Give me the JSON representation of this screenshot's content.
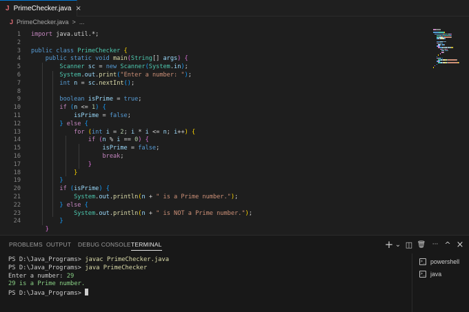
{
  "tab": {
    "icon": "java-icon",
    "icon_glyph": "J",
    "title": "PrimeChecker.java",
    "close": "×"
  },
  "breadcrumb": {
    "file": "PrimeChecker.java",
    "sep": ">",
    "more": "..."
  },
  "editor": {
    "lines": [
      {
        "n": "1",
        "tokens": [
          [
            "kw2",
            "import "
          ],
          [
            "pn",
            "java.util.*;"
          ]
        ]
      },
      {
        "n": "2",
        "tokens": []
      },
      {
        "n": "3",
        "tokens": [
          [
            "kw",
            "public class "
          ],
          [
            "ty",
            "PrimeChecker "
          ],
          [
            "br1",
            "{"
          ]
        ]
      },
      {
        "n": "4",
        "tokens": [
          [
            "kw",
            "    public static void "
          ],
          [
            "fn",
            "main"
          ],
          [
            "br2",
            "("
          ],
          [
            "ty",
            "String"
          ],
          [
            "pn",
            "[] "
          ],
          [
            "vr",
            "args"
          ],
          [
            "br2",
            ")"
          ],
          [
            "pn",
            " "
          ],
          [
            "br2",
            "{"
          ]
        ]
      },
      {
        "n": "5",
        "tokens": [
          [
            "ty",
            "        Scanner "
          ],
          [
            "vr",
            "sc"
          ],
          [
            "pn",
            " = "
          ],
          [
            "kw",
            "new "
          ],
          [
            "ty",
            "Scanner"
          ],
          [
            "br3",
            "("
          ],
          [
            "ty",
            "System"
          ],
          [
            "pn",
            "."
          ],
          [
            "vr",
            "in"
          ],
          [
            "br3",
            ")"
          ],
          [
            "pn",
            ";"
          ]
        ]
      },
      {
        "n": "6",
        "tokens": [
          [
            "ty",
            "        System"
          ],
          [
            "pn",
            "."
          ],
          [
            "vr",
            "out"
          ],
          [
            "pn",
            "."
          ],
          [
            "fn",
            "print"
          ],
          [
            "br3",
            "("
          ],
          [
            "st",
            "\"Enter a number: \""
          ],
          [
            "br3",
            ")"
          ],
          [
            "pn",
            ";"
          ]
        ]
      },
      {
        "n": "7",
        "tokens": [
          [
            "kw",
            "        int "
          ],
          [
            "vr",
            "n"
          ],
          [
            "pn",
            " = "
          ],
          [
            "vr",
            "sc"
          ],
          [
            "pn",
            "."
          ],
          [
            "fn",
            "nextInt"
          ],
          [
            "br3",
            "()"
          ],
          [
            "pn",
            ";"
          ]
        ]
      },
      {
        "n": "8",
        "tokens": []
      },
      {
        "n": "9",
        "tokens": [
          [
            "kw",
            "        boolean "
          ],
          [
            "vr",
            "isPrime"
          ],
          [
            "pn",
            " = "
          ],
          [
            "kw",
            "true"
          ],
          [
            "pn",
            ";"
          ]
        ]
      },
      {
        "n": "10",
        "tokens": [
          [
            "kw2",
            "        if "
          ],
          [
            "br3",
            "("
          ],
          [
            "vr",
            "n"
          ],
          [
            "pn",
            " <= "
          ],
          [
            "nm",
            "1"
          ],
          [
            "br3",
            ")"
          ],
          [
            "pn",
            " "
          ],
          [
            "br3",
            "{"
          ]
        ]
      },
      {
        "n": "11",
        "tokens": [
          [
            "vr",
            "            isPrime"
          ],
          [
            "pn",
            " = "
          ],
          [
            "kw",
            "false"
          ],
          [
            "pn",
            ";"
          ]
        ]
      },
      {
        "n": "12",
        "tokens": [
          [
            "br3",
            "        }"
          ],
          [
            "kw2",
            " else "
          ],
          [
            "br3",
            "{"
          ]
        ]
      },
      {
        "n": "13",
        "tokens": [
          [
            "kw2",
            "            for "
          ],
          [
            "br1",
            "("
          ],
          [
            "kw",
            "int "
          ],
          [
            "vr",
            "i"
          ],
          [
            "pn",
            " = "
          ],
          [
            "nm",
            "2"
          ],
          [
            "pn",
            "; "
          ],
          [
            "vr",
            "i"
          ],
          [
            "pn",
            " * "
          ],
          [
            "vr",
            "i"
          ],
          [
            "pn",
            " <= "
          ],
          [
            "vr",
            "n"
          ],
          [
            "pn",
            "; "
          ],
          [
            "vr",
            "i"
          ],
          [
            "pn",
            "++"
          ],
          [
            "br1",
            ")"
          ],
          [
            "pn",
            " "
          ],
          [
            "br1",
            "{"
          ]
        ]
      },
      {
        "n": "14",
        "tokens": [
          [
            "kw2",
            "                if "
          ],
          [
            "br2",
            "("
          ],
          [
            "vr",
            "n"
          ],
          [
            "pn",
            " % "
          ],
          [
            "vr",
            "i"
          ],
          [
            "pn",
            " == "
          ],
          [
            "nm",
            "0"
          ],
          [
            "br2",
            ")"
          ],
          [
            "pn",
            " "
          ],
          [
            "br2",
            "{"
          ]
        ]
      },
      {
        "n": "15",
        "tokens": [
          [
            "vr",
            "                    isPrime"
          ],
          [
            "pn",
            " = "
          ],
          [
            "kw",
            "false"
          ],
          [
            "pn",
            ";"
          ]
        ]
      },
      {
        "n": "16",
        "tokens": [
          [
            "kw2",
            "                    break"
          ],
          [
            "pn",
            ";"
          ]
        ]
      },
      {
        "n": "17",
        "tokens": [
          [
            "br2",
            "                }"
          ]
        ]
      },
      {
        "n": "18",
        "tokens": [
          [
            "br1",
            "            }"
          ]
        ]
      },
      {
        "n": "19",
        "tokens": [
          [
            "br3",
            "        }"
          ]
        ]
      },
      {
        "n": "20",
        "tokens": [
          [
            "kw2",
            "        if "
          ],
          [
            "br3",
            "("
          ],
          [
            "vr",
            "isPrime"
          ],
          [
            "br3",
            ")"
          ],
          [
            "pn",
            " "
          ],
          [
            "br3",
            "{"
          ]
        ]
      },
      {
        "n": "21",
        "tokens": [
          [
            "ty",
            "            System"
          ],
          [
            "pn",
            "."
          ],
          [
            "vr",
            "out"
          ],
          [
            "pn",
            "."
          ],
          [
            "fn",
            "println"
          ],
          [
            "br1",
            "("
          ],
          [
            "vr",
            "n"
          ],
          [
            "pn",
            " + "
          ],
          [
            "st",
            "\" is a Prime number.\""
          ],
          [
            "br1",
            ")"
          ],
          [
            "pn",
            ";"
          ]
        ]
      },
      {
        "n": "22",
        "tokens": [
          [
            "br3",
            "        }"
          ],
          [
            "kw2",
            " else "
          ],
          [
            "br3",
            "{"
          ]
        ]
      },
      {
        "n": "23",
        "tokens": [
          [
            "ty",
            "            System"
          ],
          [
            "pn",
            "."
          ],
          [
            "vr",
            "out"
          ],
          [
            "pn",
            "."
          ],
          [
            "fn",
            "println"
          ],
          [
            "br1",
            "("
          ],
          [
            "vr",
            "n"
          ],
          [
            "pn",
            " + "
          ],
          [
            "st",
            "\" is NOT a Prime number.\""
          ],
          [
            "br1",
            ")"
          ],
          [
            "pn",
            ";"
          ]
        ]
      },
      {
        "n": "24",
        "tokens": [
          [
            "br3",
            "        }"
          ]
        ]
      },
      {
        "n": "",
        "tokens": [
          [
            "br2",
            "    }"
          ]
        ]
      },
      {
        "n": "",
        "tokens": [
          [
            "br1",
            "}"
          ]
        ]
      }
    ]
  },
  "panel": {
    "tabs": [
      "PROBLEMS",
      "OUTPUT",
      "DEBUG CONSOLE",
      "TERMINAL"
    ],
    "active_tab": "TERMINAL",
    "actions": [
      {
        "name": "new-terminal-icon",
        "glyph": "+"
      },
      {
        "name": "chevron-down-icon",
        "glyph": "⌄"
      },
      {
        "name": "split-terminal-icon",
        "glyph": "◫"
      },
      {
        "name": "trash-icon",
        "glyph": "🗑"
      },
      {
        "name": "more-icon",
        "glyph": "···"
      },
      {
        "name": "maximize-icon",
        "glyph": "^"
      },
      {
        "name": "close-panel-icon",
        "glyph": "×"
      }
    ],
    "terminal": {
      "lines": [
        {
          "prompt": "PS D:\\Java_Programs> ",
          "cmd": "javac PrimeChecker.java"
        },
        {
          "prompt": "PS D:\\Java_Programs> ",
          "cmd": "java PrimeChecker"
        },
        {
          "plain": "Enter a number: ",
          "value": "29"
        },
        {
          "output": "29 is a Prime number."
        },
        {
          "prompt": "PS D:\\Java_Programs> ",
          "cursor": true
        }
      ]
    },
    "terminal_list": [
      {
        "icon": "terminal-icon",
        "label": "powershell"
      },
      {
        "icon": "terminal-icon",
        "label": "java"
      }
    ]
  }
}
